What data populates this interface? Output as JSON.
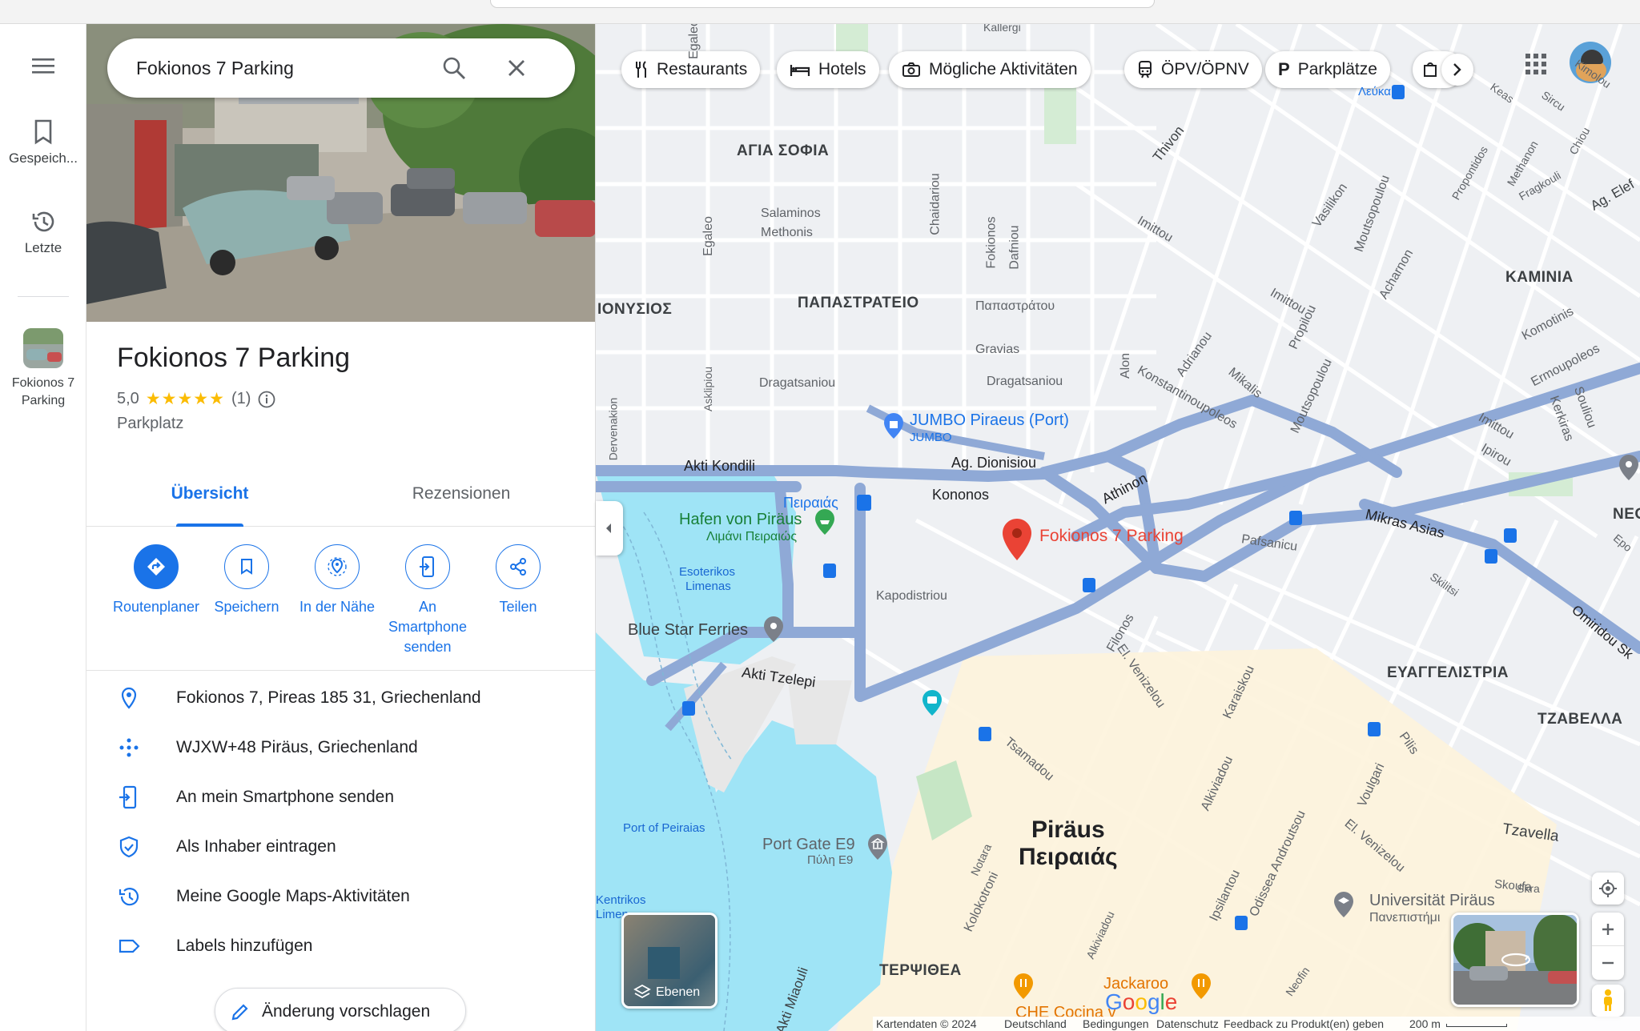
{
  "search": {
    "query": "Fokionos 7 Parking"
  },
  "rail": {
    "saved_label": "Gespeich...",
    "recent_label": "Letzte",
    "place_label": "Fokionos 7 Parking"
  },
  "place": {
    "title": "Fokionos 7 Parking",
    "rating": "5,0",
    "stars": "★★★★★",
    "review_count": "(1)",
    "category": "Parkplatz"
  },
  "tabs": {
    "overview": "Übersicht",
    "reviews": "Rezensionen"
  },
  "actions": {
    "route": "Routenplaner",
    "save": "Speichern",
    "nearby": "In der Nähe",
    "send_line1": "An",
    "send_line2": "Smartphone",
    "send_line3": "senden",
    "share": "Teilen"
  },
  "info": {
    "address": "Fokionos 7, Pireas 185 31, Griechenland",
    "plus_code": "WJXW+48 Piräus, Griechenland",
    "send_phone": "An mein Smartphone senden",
    "claim": "Als Inhaber eintragen",
    "activity": "Meine Google Maps-Aktivitäten",
    "labels": "Labels hinzufügen"
  },
  "suggest_edit": "Änderung vorschlagen",
  "chips": {
    "restaurants": "Restaurants",
    "hotels": "Hotels",
    "activities": "Mögliche Aktivitäten",
    "transit": "ÖPV/ÖPNV",
    "parking": "Parkplätze"
  },
  "map": {
    "layers": "Ebenen",
    "marker": "Fokionos 7 Parking",
    "city1": "Piräus",
    "city2": "Πειραιάς",
    "districts": {
      "agia_sofia": "ΑΓΙΑ ΣΟΦΙΑ",
      "papastrateio": "ΠΑΠΑΣΤΡΑΤΕΙΟ",
      "dionysios": "ΙΟΝΥΣΙΟΣ",
      "kaminia": "ΚΑΜΙΝΙΑ",
      "neo": "ΝΕΟ",
      "evangelistria": "ΕΥΑΓΓΕΛΙΣΤΡΙΑ",
      "tzavella": "ΤΖΑΒΕΛΛΑ",
      "terpsithea": "ΤΕΡΨΙΘΕΑ"
    },
    "pois": {
      "jumbo": "JUMBO Piraeus (Port)",
      "jumbo_sub": "JUMBO",
      "harbour": "Hafen von Piräus",
      "harbour_sub": "Λιμάνι Πειραιώς",
      "bluestar": "Blue Star Ferries",
      "portgate": "Port Gate E9",
      "portgate_sub": "Πύλη E9",
      "university": "Universität Piräus",
      "university_sub": "Πανεπιστήμι",
      "jackaroo": "Jackaroo",
      "chef": "CHE Cocina v",
      "piraeus_station": "Πειραιάς",
      "lefka": "Λεύκα"
    },
    "streets": {
      "akti_kondili": "Akti Kondili",
      "ag_dionisiou": "Ag. Dionisiou",
      "kononos": "Kononos",
      "athinon": "Athinon",
      "mikras_asias": "Mikras Asias",
      "pafsanicu": "Pafsanicu",
      "kapodistriou": "Kapodistriou",
      "akti_tzelepi": "Akti Tzelepi",
      "thivon": "Thivon",
      "egaleo": "Egaleo",
      "salaminos": "Salaminos",
      "methonis": "Methonis",
      "chaidariou": "Chaidariou",
      "fokionos": "Fokionos",
      "dafniou": "Dafniou",
      "papastratou": "Παπαστράτου",
      "gravias": "Gravias",
      "dragatsaniou": "Dragatsaniou",
      "dragatsaniou_gr": "Dragatsaniou",
      "askipiou": "Asklipiou",
      "dervenakion": "Dervenakion",
      "alon": "Alon",
      "konstantinoupoleos": "Konstantinoupoleos",
      "adrianou": "Adrianou",
      "mikalis": "Mikalis",
      "moutsopoulou": "Moutsopoulou",
      "propilou": "Propilou",
      "imittou": "Imittou",
      "vasilikon": "Vasilikon",
      "acharnon": "Acharnon",
      "komotinis": "Komotinis",
      "ermoupoleos": "Ermoupoleos",
      "kerkiras": "Kerkiras",
      "souliou": "Souliou",
      "ipirou": "Ipirou",
      "omiridou": "Omiridou Sk",
      "skilitsi": "Skilitsi",
      "filonos": "Filonos",
      "el_venizelou": "El. Venizelou",
      "karaiskou": "Karaiskou",
      "tsamadou": "Tsamadou",
      "alkiviadou": "Alkiviadou",
      "pilis": "Pilis",
      "voulgari": "Voulgari",
      "tzavella_st": "Tzavella",
      "skoufa": "Skoufa",
      "notara": "Notara",
      "kolokotroni": "Kolokotroni",
      "ipsilantou": "Ipsilantou",
      "odissea": "Odissea Androutsou",
      "akti_miaouli": "Akti Miaouli",
      "esoterikos": "Esoterikos",
      "limenas": "Limenas",
      "port_of_peiraias": "Port of Peiraias",
      "kentrikos": "Kentrikos",
      "limen": "Limen",
      "kallergi": "Kallergi",
      "keas": "Keas",
      "kimolou": "Kimolou",
      "sircu": "Sircu",
      "chiou": "Chiou",
      "methanon": "Methanon",
      "propontidos": "Propontidos",
      "fragkouli": "Fragkouli",
      "ag_elef": "Ag. Elef",
      "epo": "Epo",
      "neofin": "Neofin",
      "skra": "Skra"
    }
  },
  "footer": {
    "map_data": "Kartendaten © 2024",
    "country": "Deutschland",
    "terms": "Bedingungen",
    "privacy": "Datenschutz",
    "feedback": "Feedback zu Produkt(en) geben",
    "scale": "200 m"
  }
}
